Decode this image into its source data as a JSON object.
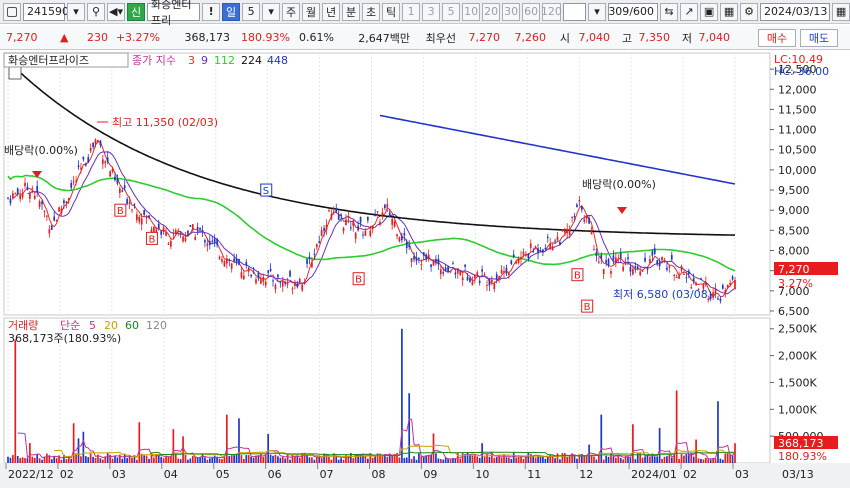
{
  "toolbar": {
    "code": "241590",
    "stock_name": "화승엔터프리",
    "fav_mark": "!",
    "period_sel": "일",
    "period_num": "5",
    "periods": [
      "주",
      "월",
      "년",
      "분",
      "초",
      "틱"
    ],
    "nums": [
      "1",
      "3",
      "5",
      "10",
      "20",
      "30",
      "60",
      "120"
    ],
    "count": "309",
    "total": "/600",
    "date": "2024/03/13"
  },
  "quote": {
    "price": "7,270",
    "arrow": "▲",
    "change": "230",
    "pct": "+3.27%",
    "volume": "368,173",
    "vol_ratio": "180.93%",
    "turnover": "0.61%",
    "amount": "2,647백만",
    "pref_label": "최우선",
    "ask": "7,270",
    "bid": "7,260",
    "open_label": "시",
    "open": "7,040",
    "high_label": "고",
    "high": "7,350",
    "low_label": "저",
    "low": "7,040",
    "buy": "매수",
    "sell": "매도"
  },
  "price_panel": {
    "name": "화승엔터프라이즈",
    "ma_label": "종가 지수",
    "ma": [
      "3",
      "9",
      "112",
      "224",
      "448"
    ],
    "lc": "LC:10.49",
    "hc": "HC:-36.00",
    "high_note": "최고 11,350 (02/03)",
    "low_note": "최저 6,580 (03/08)",
    "div1": "배당락(0.00%)",
    "div2": "배당락(0.00%)",
    "marker_s": "S",
    "marker_b": "B",
    "price_tag": "7,270",
    "pct_tag": "3.27%"
  },
  "volume_panel": {
    "label": "거래량",
    "ma_label": "단순",
    "mas": [
      "5",
      "20",
      "60",
      "120"
    ],
    "current": "368,173주(180.93%)",
    "tag": "368,173",
    "pct_tag": "180.93%"
  },
  "x_labels": [
    "2022/12",
    "02",
    "03",
    "04",
    "05",
    "06",
    "07",
    "08",
    "09",
    "10",
    "11",
    "12",
    "2024/01",
    "02",
    "03"
  ],
  "x_last": "03/13",
  "chart_data": {
    "type": "line",
    "y_ticks": [
      "12,500",
      "12,000",
      "11,500",
      "11,000",
      "10,500",
      "10,000",
      "9,500",
      "9,000",
      "8,500",
      "8,000",
      "7,500",
      "7,000",
      "6,500"
    ],
    "vol_ticks": [
      "2,500K",
      "2,000K",
      "1,500K",
      "1,000K",
      "500,000"
    ],
    "ylim": [
      6400,
      12900
    ],
    "vol_lim": [
      0,
      2700000
    ],
    "colors": {
      "up": "#e81c1c",
      "down": "#1a38c8",
      "ma3": "#e82a2a",
      "ma9": "#6a2ec4",
      "ma112": "#2ecc2e",
      "ma224": "#111111",
      "ma448": "#2233cc"
    }
  }
}
